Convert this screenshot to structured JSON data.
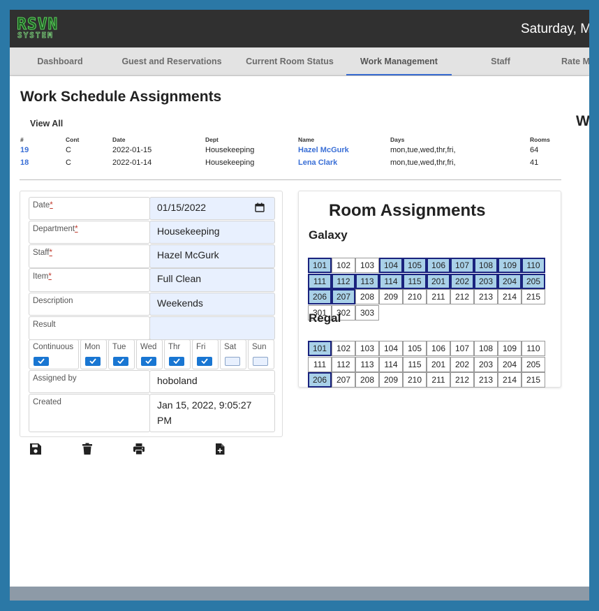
{
  "app": {
    "logo_text": "RSVN",
    "logo_sub": "SYSTEM",
    "date_text": "Saturday, M"
  },
  "tabs": [
    {
      "label": "Dashboard"
    },
    {
      "label": "Guest and Reservations"
    },
    {
      "label": "Current Room Status"
    },
    {
      "label": "Work Management",
      "active": true
    },
    {
      "label": "Staff"
    },
    {
      "label": "Rate M"
    }
  ],
  "page": {
    "title": "Work Schedule Assignments",
    "right_title_cut": "W",
    "view_all": "View All"
  },
  "schedule_table": {
    "headers": [
      "#",
      "Cont",
      "Date",
      "Dept",
      "Name",
      "Days",
      "Rooms"
    ],
    "rows": [
      {
        "id": "19",
        "cont": "C",
        "date": "2022-01-15",
        "dept": "Housekeeping",
        "name": "Hazel McGurk",
        "days": "mon,tue,wed,thr,fri,",
        "rooms": "64"
      },
      {
        "id": "18",
        "cont": "C",
        "date": "2022-01-14",
        "dept": "Housekeeping",
        "name": "Lena Clark",
        "days": "mon,tue,wed,thr,fri,",
        "rooms": "41"
      }
    ]
  },
  "form": {
    "date": {
      "label": "Date",
      "req": "*",
      "value": "01/15/2022"
    },
    "department": {
      "label": "Department",
      "req": "*",
      "value": "Housekeeping"
    },
    "staff": {
      "label": "Staff",
      "req": "*",
      "value": "Hazel McGurk"
    },
    "item": {
      "label": "Item",
      "req": "*",
      "value": "Full Clean"
    },
    "description": {
      "label": "Description",
      "value": "Weekends"
    },
    "result": {
      "label": "Result",
      "value": ""
    },
    "days": [
      {
        "label": "Continuous",
        "checked": true
      },
      {
        "label": "Mon",
        "checked": true
      },
      {
        "label": "Tue",
        "checked": true
      },
      {
        "label": "Wed",
        "checked": true
      },
      {
        "label": "Thr",
        "checked": true
      },
      {
        "label": "Fri",
        "checked": true
      },
      {
        "label": "Sat",
        "checked": false
      },
      {
        "label": "Sun",
        "checked": false
      }
    ],
    "assigned_by": {
      "label": "Assigned by",
      "value": "hoboland"
    },
    "created": {
      "label": "Created",
      "value_line1": "Jan 15, 2022, 9:05:27",
      "value_line2": "PM"
    }
  },
  "toolbar": {
    "icons": [
      "save-icon",
      "delete-icon",
      "print-icon",
      "new-document-icon"
    ]
  },
  "room_assignments": {
    "title": "Room Assignments",
    "groups": [
      {
        "name": "Galaxy",
        "rows": [
          [
            "101",
            "102",
            "103",
            "104",
            "105",
            "106",
            "107",
            "108",
            "109",
            "110"
          ],
          [
            "111",
            "112",
            "113",
            "114",
            "115",
            "201",
            "202",
            "203",
            "204",
            "205"
          ],
          [
            "206",
            "207",
            "208",
            "209",
            "210",
            "211",
            "212",
            "213",
            "214",
            "215"
          ],
          [
            "301",
            "302",
            "303"
          ]
        ],
        "selected": [
          "101",
          "104",
          "105",
          "106",
          "107",
          "108",
          "109",
          "110",
          "111",
          "112",
          "113",
          "114",
          "115",
          "201",
          "202",
          "203",
          "204",
          "205",
          "206",
          "207"
        ]
      },
      {
        "name": "Regal",
        "rows": [
          [
            "101",
            "102",
            "103",
            "104",
            "105",
            "106",
            "107",
            "108",
            "109",
            "110"
          ],
          [
            "111",
            "112",
            "113",
            "114",
            "115",
            "201",
            "202",
            "203",
            "204",
            "205"
          ],
          [
            "206",
            "207",
            "208",
            "209",
            "210",
            "211",
            "212",
            "213",
            "214",
            "215"
          ]
        ],
        "selected": [
          "101",
          "206"
        ]
      }
    ]
  },
  "colors": {
    "accent": "#3a6fd6",
    "selected_room_bg": "#a9d1e8",
    "selected_room_border": "#1a237e",
    "checkbox": "#1976d2"
  }
}
